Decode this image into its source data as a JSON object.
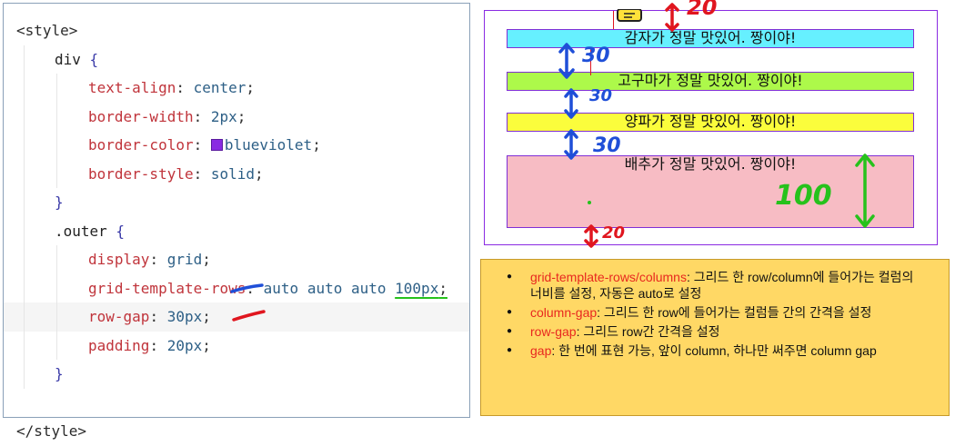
{
  "code": {
    "lines": [
      {
        "t1": "<style>"
      },
      {
        "sel": "div",
        "brace": " {"
      },
      {
        "prop": "text-align",
        "val": "center"
      },
      {
        "prop": "border-width",
        "val": "2px"
      },
      {
        "prop": "border-color",
        "val": "blueviolet"
      },
      {
        "prop": "border-style",
        "val": "solid"
      },
      {
        "brace": "}"
      },
      {
        "sel": ".outer",
        "brace": " {"
      },
      {
        "prop": "display",
        "val": "grid"
      },
      {
        "prop": "grid-template-rows",
        "val": "auto auto auto",
        "val2": "100px"
      },
      {
        "prop": "row-gap",
        "val": "30px"
      },
      {
        "prop": "padding",
        "val": "20px"
      },
      {
        "brace": "}"
      },
      {
        "t1": ""
      },
      {
        "t1": "</style>"
      }
    ]
  },
  "preview": {
    "rows": [
      {
        "text": "감자가 정말 맛있어. 짱이야!",
        "color": "#66f0ff"
      },
      {
        "text": "고구마가 정말 맛있어. 짱이야!",
        "color": "#adf94a"
      },
      {
        "text": "양파가 정말 맛있어. 짱이야!",
        "color": "#fbfd3c"
      },
      {
        "text": "배추가 정말 맛있어. 짱이야!",
        "color": "#f7bcc4"
      }
    ],
    "annotations": {
      "top_padding": "20",
      "gap1": "30",
      "gap2": "30",
      "gap3": "30",
      "row4_height": "100",
      "bottom_padding": "20"
    }
  },
  "notes": [
    {
      "key": "grid-template-rows/columns",
      "text": ": 그리드 한 row/column에 들어가는 컬럼의 너비를 설정, 자동은 auto로 설정"
    },
    {
      "key": "column-gap",
      "text": ": 그리드 한 row에 들어가는 컬럼들 간의 간격을 설정"
    },
    {
      "key": "row-gap",
      "text": ": 그리드 row간 간격을 설정"
    },
    {
      "key": "gap",
      "text": ": 한 번에 표현 가능, 앞이 column, 하나만 써주면 column gap"
    }
  ],
  "colors": {
    "border": "#8a2be2",
    "note_bg": "#ffd865",
    "note_key": "#e8281f",
    "ann_blue": "#1f4fd8",
    "ann_red": "#e0161f",
    "ann_green": "#26c21c"
  }
}
